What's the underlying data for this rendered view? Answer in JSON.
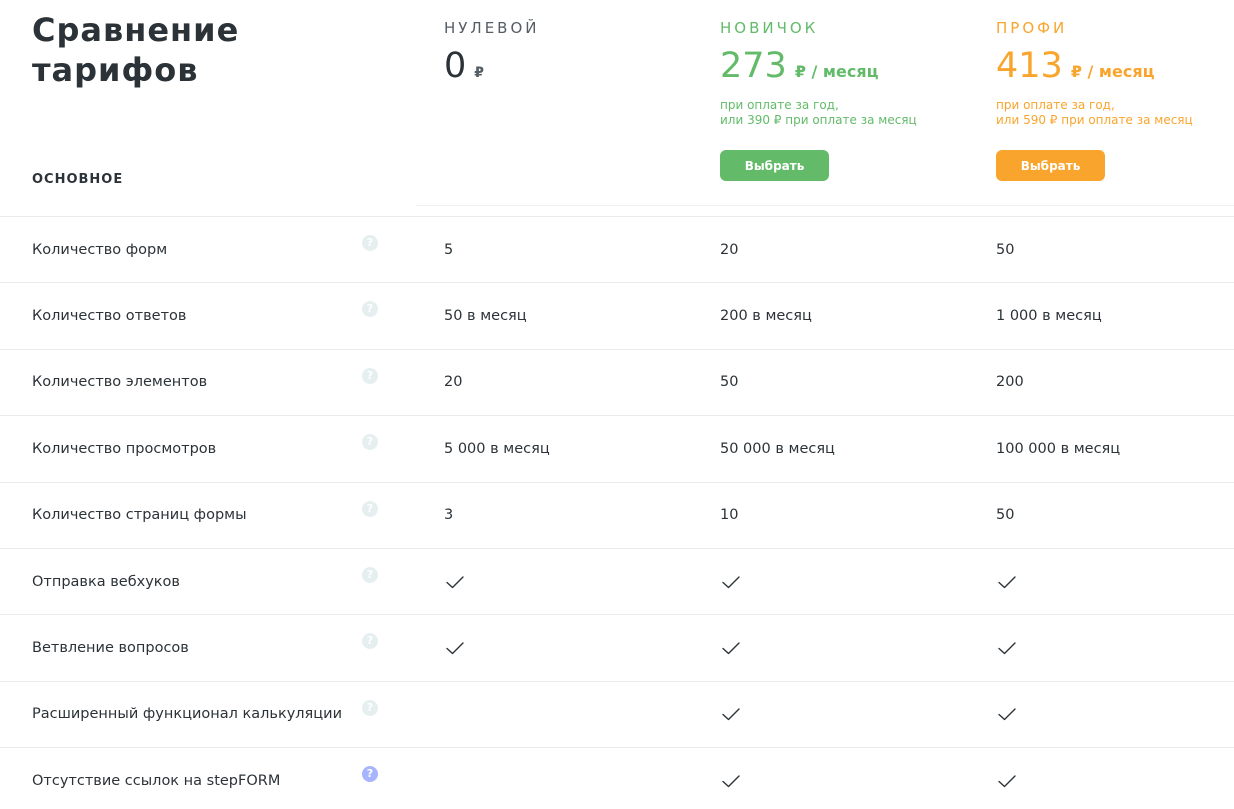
{
  "header": {
    "title": "Сравнение тарифов",
    "section": "ОСНОВНОЕ"
  },
  "plans": [
    {
      "name": "НУЛЕВОЙ",
      "price": "0",
      "unit": "₽",
      "note": "",
      "button": ""
    },
    {
      "name": "НОВИЧОК",
      "price": "273",
      "unit": "₽ / месяц",
      "note": "при оплате за год,\nили 390 ₽ при оплате за месяц",
      "button": "Выбрать",
      "color": "#63bb6a"
    },
    {
      "name": "ПРОФИ",
      "price": "413",
      "unit": "₽ / месяц",
      "note": "при оплате за год,\nили 590 ₽ при оплате за месяц",
      "button": "Выбрать",
      "color": "#f9a52d"
    }
  ],
  "features": [
    {
      "label": "Количество форм",
      "values": [
        "5",
        "20",
        "50"
      ]
    },
    {
      "label": "Количество ответов",
      "values": [
        "50 в месяц",
        "200 в месяц",
        "1 000 в месяц"
      ]
    },
    {
      "label": "Количество элементов",
      "values": [
        "20",
        "50",
        "200"
      ]
    },
    {
      "label": "Количество просмотров",
      "values": [
        "5 000 в месяц",
        "50 000 в месяц",
        "100 000 в месяц"
      ]
    },
    {
      "label": "Количество страниц формы",
      "values": [
        "3",
        "10",
        "50"
      ]
    },
    {
      "label": "Отправка вебхуков",
      "checks": [
        true,
        true,
        true
      ]
    },
    {
      "label": "Ветвление вопросов",
      "checks": [
        true,
        true,
        true
      ]
    },
    {
      "label": "Расширенный функционал калькуляции",
      "checks": [
        false,
        true,
        true
      ]
    },
    {
      "label": "Отсутствие ссылок на stepFORM",
      "checks": [
        false,
        true,
        true
      ]
    }
  ],
  "icons": {
    "help": "question-mark-icon",
    "check": "checkmark-icon"
  },
  "help_glyph": "?"
}
